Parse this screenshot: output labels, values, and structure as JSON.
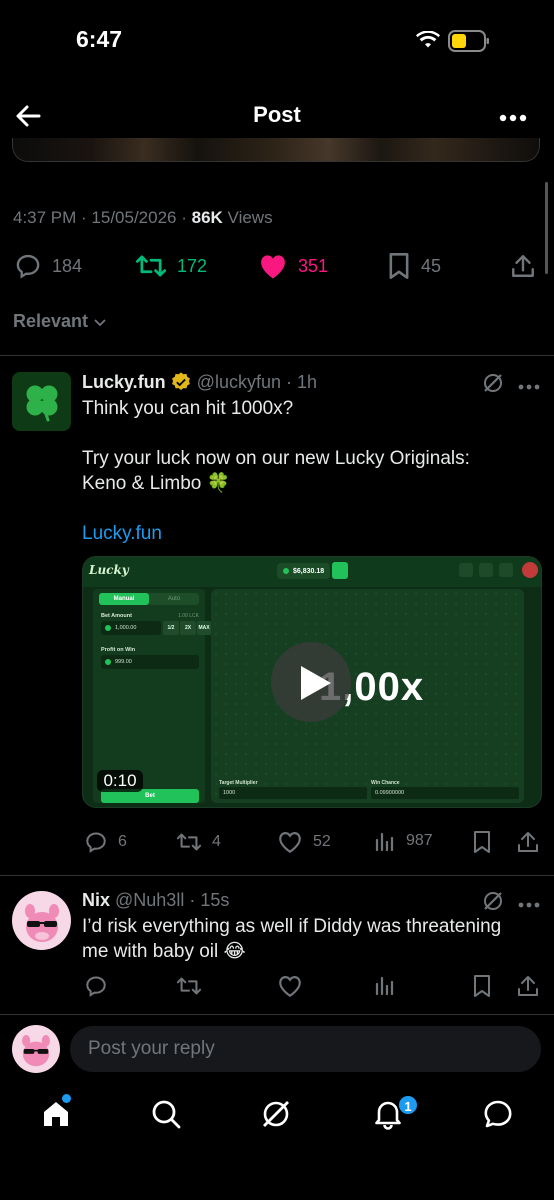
{
  "status_bar": {
    "time": "6:47",
    "battery_color": "#ffd60a"
  },
  "header": {
    "title": "Post"
  },
  "post_meta": {
    "time": "4:37 PM",
    "date": "15/05/2026",
    "views_count": "86K",
    "views_label": "Views"
  },
  "post_actions": {
    "replies": "184",
    "reposts": "172",
    "likes": "351",
    "bookmarks": "45"
  },
  "filter": {
    "label": "Relevant"
  },
  "tweet1": {
    "name": "Lucky.fun",
    "handle": "@luckyfun",
    "time": "· 1h",
    "line1": "Think you can hit 1000x?",
    "line2": "Try your luck now on our new Lucky Originals:",
    "line3": "Keno & Limbo 🍀",
    "link": "Lucky.fun",
    "media": {
      "logo": "Lucky",
      "balance": "$6,830.18",
      "tab_manual": "Manual",
      "tab_auto": "Auto",
      "bet_amount_label": "Bet Amount",
      "bet_amount_right": "1.00 LCK",
      "bet_value": "1,000.00",
      "half": "1/2",
      "double": "2X",
      "max": "MAX",
      "profit_label": "Profit on Win",
      "profit_value": "999.00",
      "bet_button": "Bet",
      "multiplier": "1,00x",
      "target_label": "Target Multiplier",
      "target_value": "1000",
      "chance_label": "Win Chance",
      "chance_value": "0.09900000",
      "duration": "0:10"
    },
    "actions": {
      "replies": "6",
      "reposts": "4",
      "likes": "52",
      "views": "987"
    }
  },
  "tweet2": {
    "name": "Nix",
    "handle": "@Nuh3ll",
    "time": "· 15s",
    "line1": "I’d risk everything as well if Diddy was threatening",
    "line2": "me with baby oil 😂"
  },
  "reply": {
    "placeholder": "Post your reply"
  },
  "nav": {
    "notifications_badge": "1"
  },
  "colors": {
    "accent": "#1d9bf0",
    "like": "#f91880",
    "repost": "#00ba7c",
    "muted": "#71767b"
  }
}
